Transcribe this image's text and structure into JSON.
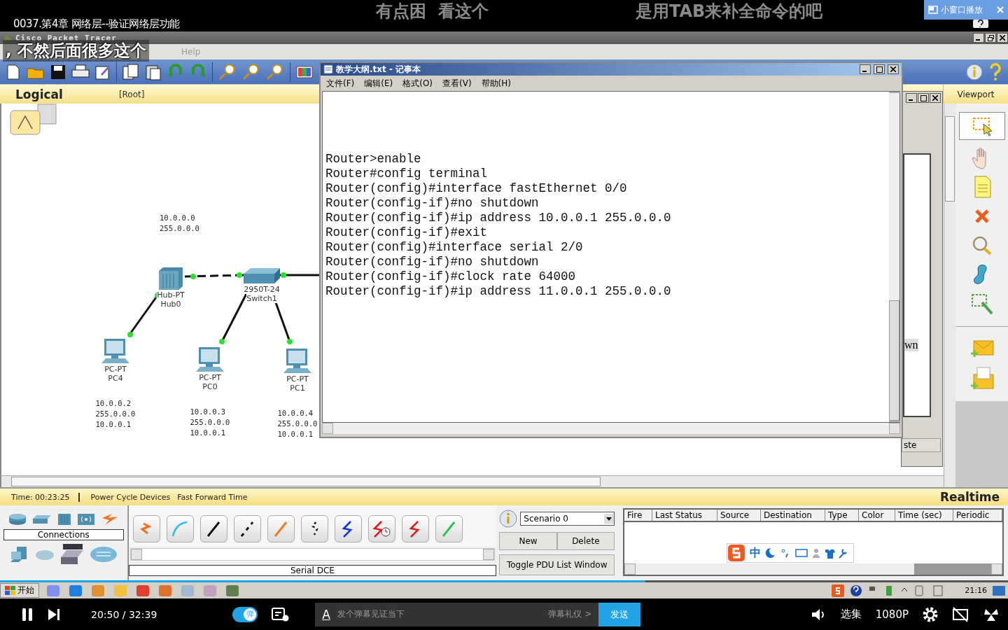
{
  "player": {
    "title": "0037.第4章 网络层--验证网络层功能",
    "pip_button": "小窗口播放",
    "danmaku": [
      {
        "text": "有点困  看这个"
      },
      {
        "text": "是用TAB来补全命令的吧"
      }
    ],
    "subtitle": ", 不然后面很多这个",
    "controls": {
      "current": "20:50",
      "separator": "/",
      "total": "32:39",
      "progress": {
        "level": 0.64
      },
      "danmaku_on": true,
      "danmaku_toggle": "弹",
      "input_style": "A",
      "input_placeholder": "发个弹幕见证当下",
      "etiquette": "弹幕礼仪 >",
      "send": "发送",
      "episodes": "选集",
      "quality": "1080P"
    }
  },
  "packet_tracer": {
    "title": "Cisco Packet Tracer",
    "menu": [
      "Help"
    ],
    "logical_tab": "Logical",
    "root": "[Root]",
    "viewport": "Viewport",
    "note": [
      "10.0.0.0",
      "255.0.0.0"
    ],
    "nodes": [
      {
        "kind": "hub",
        "model": "Hub-PT",
        "name": "Hub0"
      },
      {
        "kind": "switch",
        "model": "2950T-24",
        "name": "Switch1"
      },
      {
        "kind": "pc",
        "model": "PC-PT",
        "name": "PC4",
        "config": [
          "10.0.0.2",
          "255.0.0.0",
          "10.0.0.1"
        ]
      },
      {
        "kind": "pc",
        "model": "PC-PT",
        "name": "PC0",
        "config": [
          "10.0.0.3",
          "255.0.0.0",
          "10.0.0.1"
        ]
      },
      {
        "kind": "pc",
        "model": "PC-PT",
        "name": "PC1",
        "config": [
          "10.0.0.4",
          "255.0.0.0",
          "10.0.0.1"
        ]
      }
    ],
    "time": "Time: 00:23:25",
    "power_cycle": "Power Cycle Devices",
    "fast_forward": "Fast Forward Time",
    "mode": "Realtime",
    "device_category": "Connections",
    "connections": [
      {
        "kind": "auto"
      },
      {
        "kind": "console"
      },
      {
        "kind": "straight"
      },
      {
        "kind": "crossover"
      },
      {
        "kind": "fiber"
      },
      {
        "kind": "phone"
      },
      {
        "kind": "coaxial"
      },
      {
        "kind": "serial_dce"
      },
      {
        "kind": "serial_dte"
      },
      {
        "kind": "octal"
      }
    ],
    "connection_name": "Serial DCE",
    "scenario": "Scenario 0",
    "buttons": [
      "New",
      "Delete"
    ],
    "toggle_pdu": "Toggle PDU List Window",
    "pdu_columns": [
      "Fire",
      "Last Status",
      "Source",
      "Destination",
      "Type",
      "Color",
      "Time (sec)",
      "Periodic"
    ]
  },
  "notepad": {
    "title": "教学大纲.txt - 记事本",
    "menu": [
      "文件(F)",
      "编辑(E)",
      "格式(O)",
      "查看(V)",
      "帮助(H)"
    ],
    "lines": [
      "Router>enable",
      "Router#config terminal",
      "Router(config)#interface fastEthernet 0/0",
      "Router(config-if)#no shutdown",
      "Router(config-if)#ip address 10.0.0.1 255.0.0.0",
      "Router(config-if)#exit",
      "Router(config)#interface serial 2/0",
      "Router(config-if)#no shutdown",
      "Router(config-if)#clock rate 64000",
      "Router(config-if)#ip address 11.0.0.1 255.0.0.0"
    ]
  },
  "background_window": {
    "text": "wn",
    "button": "ste"
  },
  "ime": {
    "mode": "中"
  },
  "taskbar": {
    "start": "开始",
    "clock": "21:16"
  }
}
